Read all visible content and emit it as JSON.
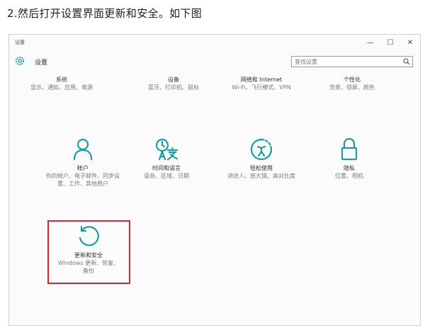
{
  "article": {
    "heading": "2.然后打开设置界面更新和安全。如下图"
  },
  "window": {
    "title": "设置",
    "controls": {
      "minimize": "—",
      "maximize": "☐",
      "close": "✕"
    },
    "header": {
      "title": "设置",
      "search_placeholder": "查找设置"
    }
  },
  "tiles": [
    {
      "title": "系统",
      "desc": "显示、通知、应用、电源"
    },
    {
      "title": "设备",
      "desc": "蓝牙、打印机、鼠标"
    },
    {
      "title": "网络和 Internet",
      "desc": "Wi-Fi、飞行模式、VPN"
    },
    {
      "title": "个性化",
      "desc": "背景、锁屏、颜色"
    },
    {
      "title": "帐户",
      "desc": "你的帐户、电子邮件、同步设置、工作、其他用户"
    },
    {
      "title": "时间和语言",
      "desc": "语音、区域、日期"
    },
    {
      "title": "轻松使用",
      "desc": "讲述人、放大镜、高对比度"
    },
    {
      "title": "隐私",
      "desc": "位置、相机"
    },
    {
      "title": "更新和安全",
      "desc": "Windows 更新、恢复、备份"
    }
  ],
  "colors": {
    "accent": "#1d9ba0",
    "highlight": "#d9262e"
  }
}
